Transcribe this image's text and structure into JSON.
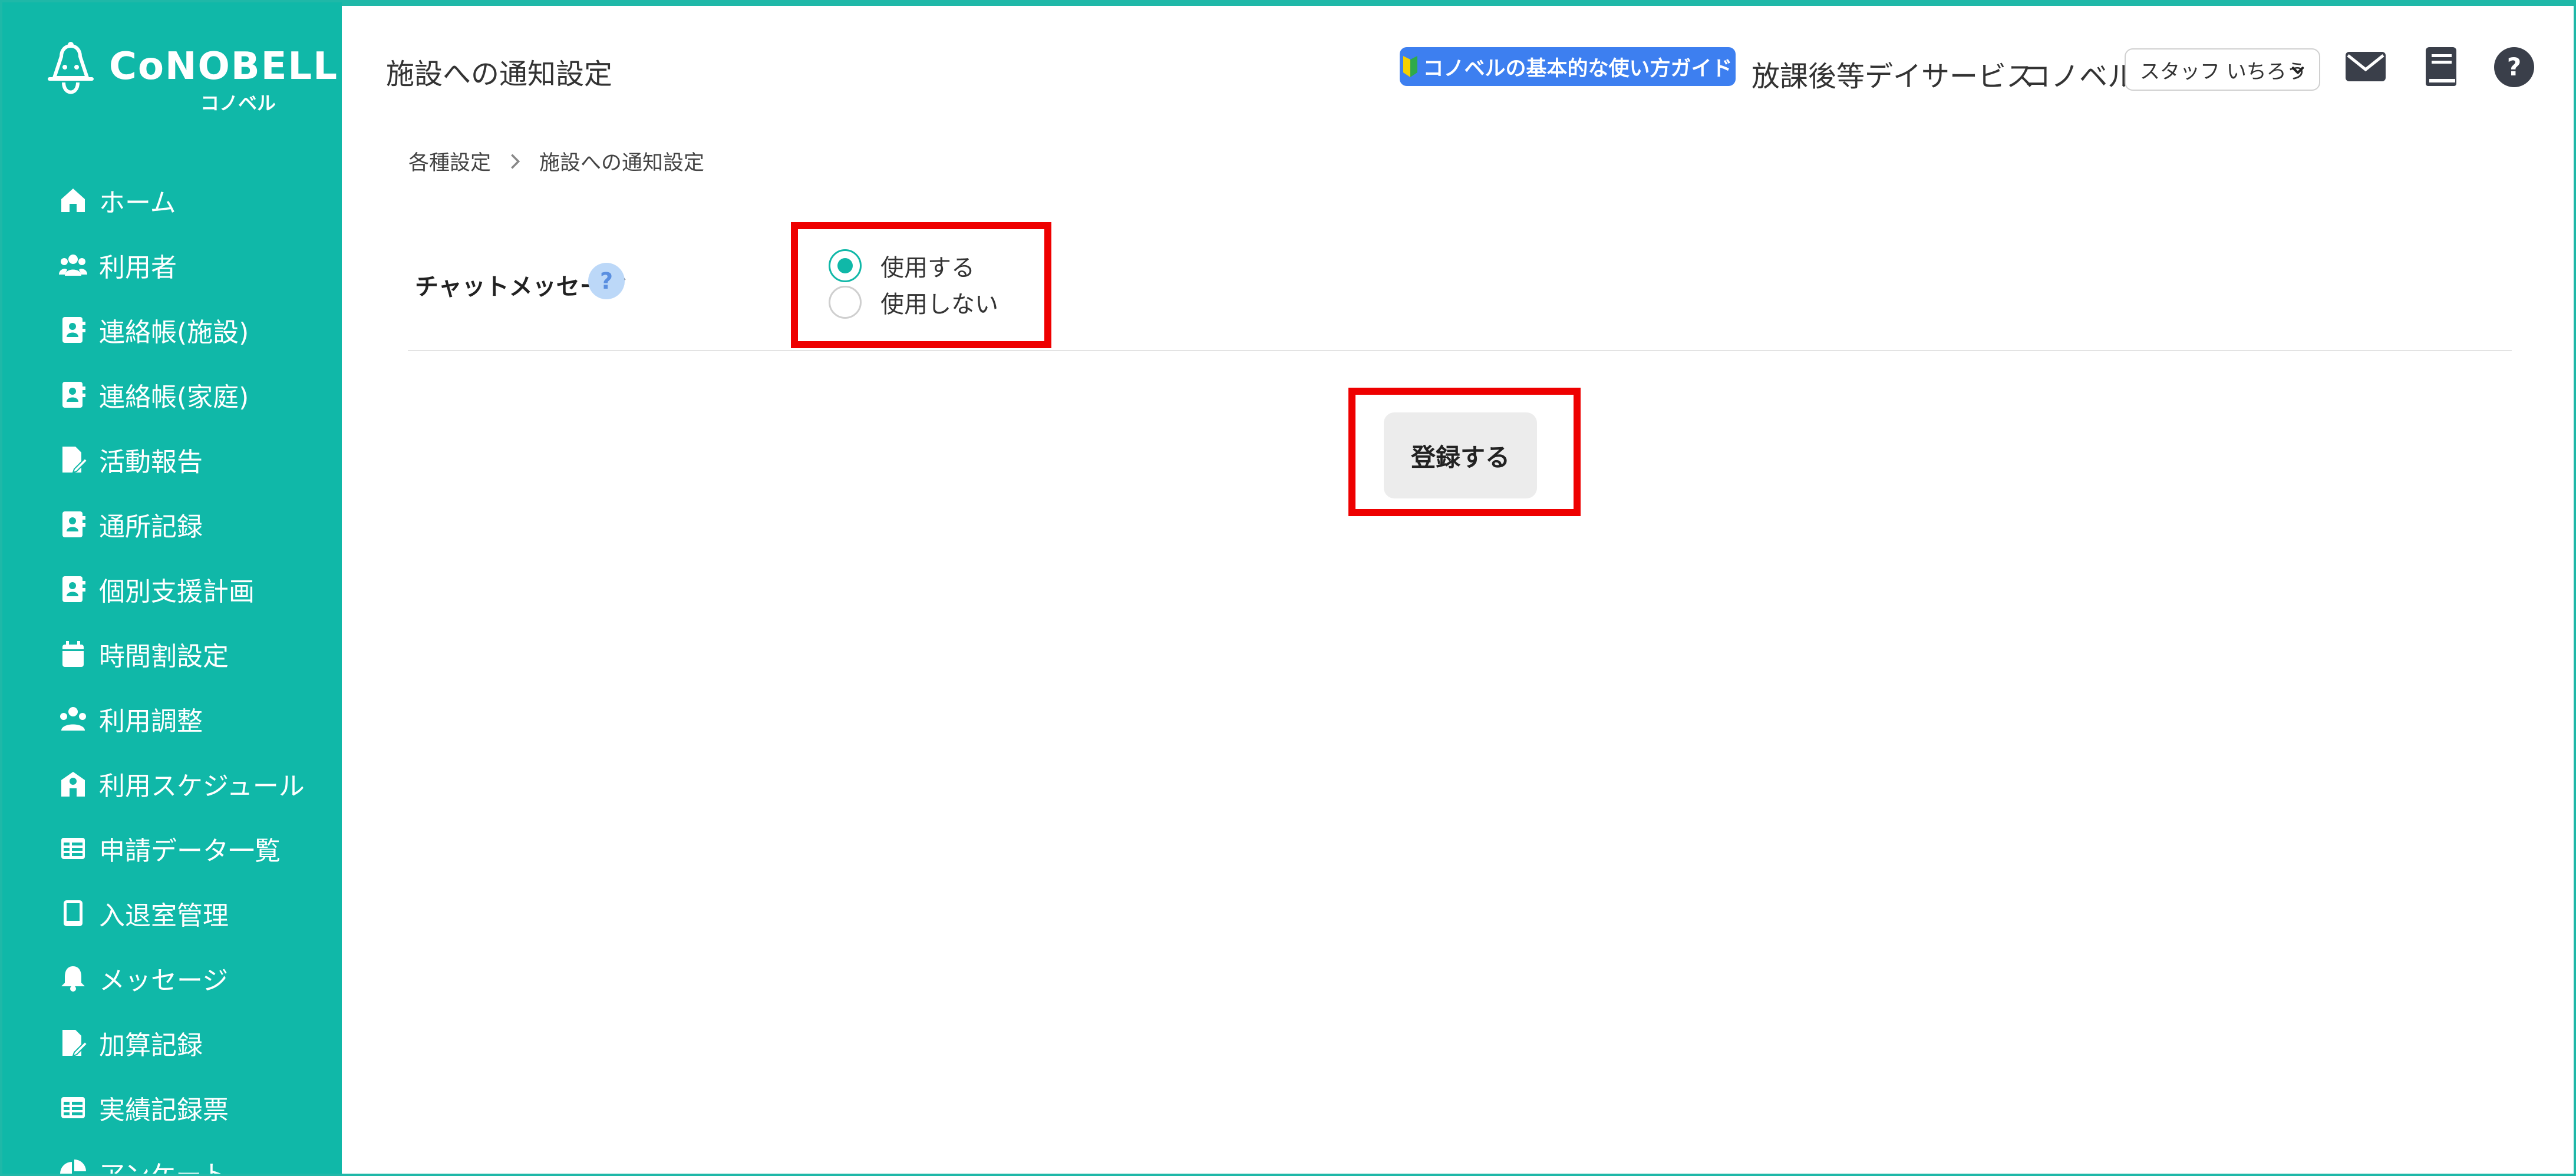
{
  "brand": {
    "name": "CoNOBELL",
    "subname": "コノベル"
  },
  "sidebar": {
    "items": [
      {
        "label": "ホーム",
        "icon": "home-icon"
      },
      {
        "label": "利用者",
        "icon": "users-icon"
      },
      {
        "label": "連絡帳(施設)",
        "icon": "contact-book-icon"
      },
      {
        "label": "連絡帳(家庭)",
        "icon": "contact-book-icon"
      },
      {
        "label": "活動報告",
        "icon": "file-edit-icon"
      },
      {
        "label": "通所記録",
        "icon": "contact-book-icon"
      },
      {
        "label": "個別支援計画",
        "icon": "contact-book-icon"
      },
      {
        "label": "時間割設定",
        "icon": "calendar-icon"
      },
      {
        "label": "利用調整",
        "icon": "users-cog-icon"
      },
      {
        "label": "利用スケジュール",
        "icon": "school-icon"
      },
      {
        "label": "申請データ一覧",
        "icon": "table-icon"
      },
      {
        "label": "入退室管理",
        "icon": "tablet-icon"
      },
      {
        "label": "メッセージ",
        "icon": "bell-icon"
      },
      {
        "label": "加算記録",
        "icon": "file-edit-icon"
      },
      {
        "label": "実績記録票",
        "icon": "table-icon"
      },
      {
        "label": "アンケート",
        "icon": "pie-chart-icon"
      }
    ]
  },
  "header": {
    "title": "施設への通知設定",
    "guide_label": "コノベルの基本的な使い方ガイド",
    "facility_name": "放課後等デイサービス",
    "company_name": "コノベル",
    "staff_select": "スタッフ いちろう"
  },
  "breadcrumb": {
    "parent": "各種設定",
    "current": "施設への通知設定"
  },
  "form": {
    "chat_label": "チャットメッセージ",
    "help_mark": "?",
    "options": [
      {
        "label": "使用する",
        "checked": true
      },
      {
        "label": "使用しない",
        "checked": false
      }
    ],
    "submit_label": "登録する"
  },
  "colors": {
    "sidebar": "#10b8a8",
    "guide_button": "#3d7ff0",
    "highlight": "#ee0000"
  }
}
